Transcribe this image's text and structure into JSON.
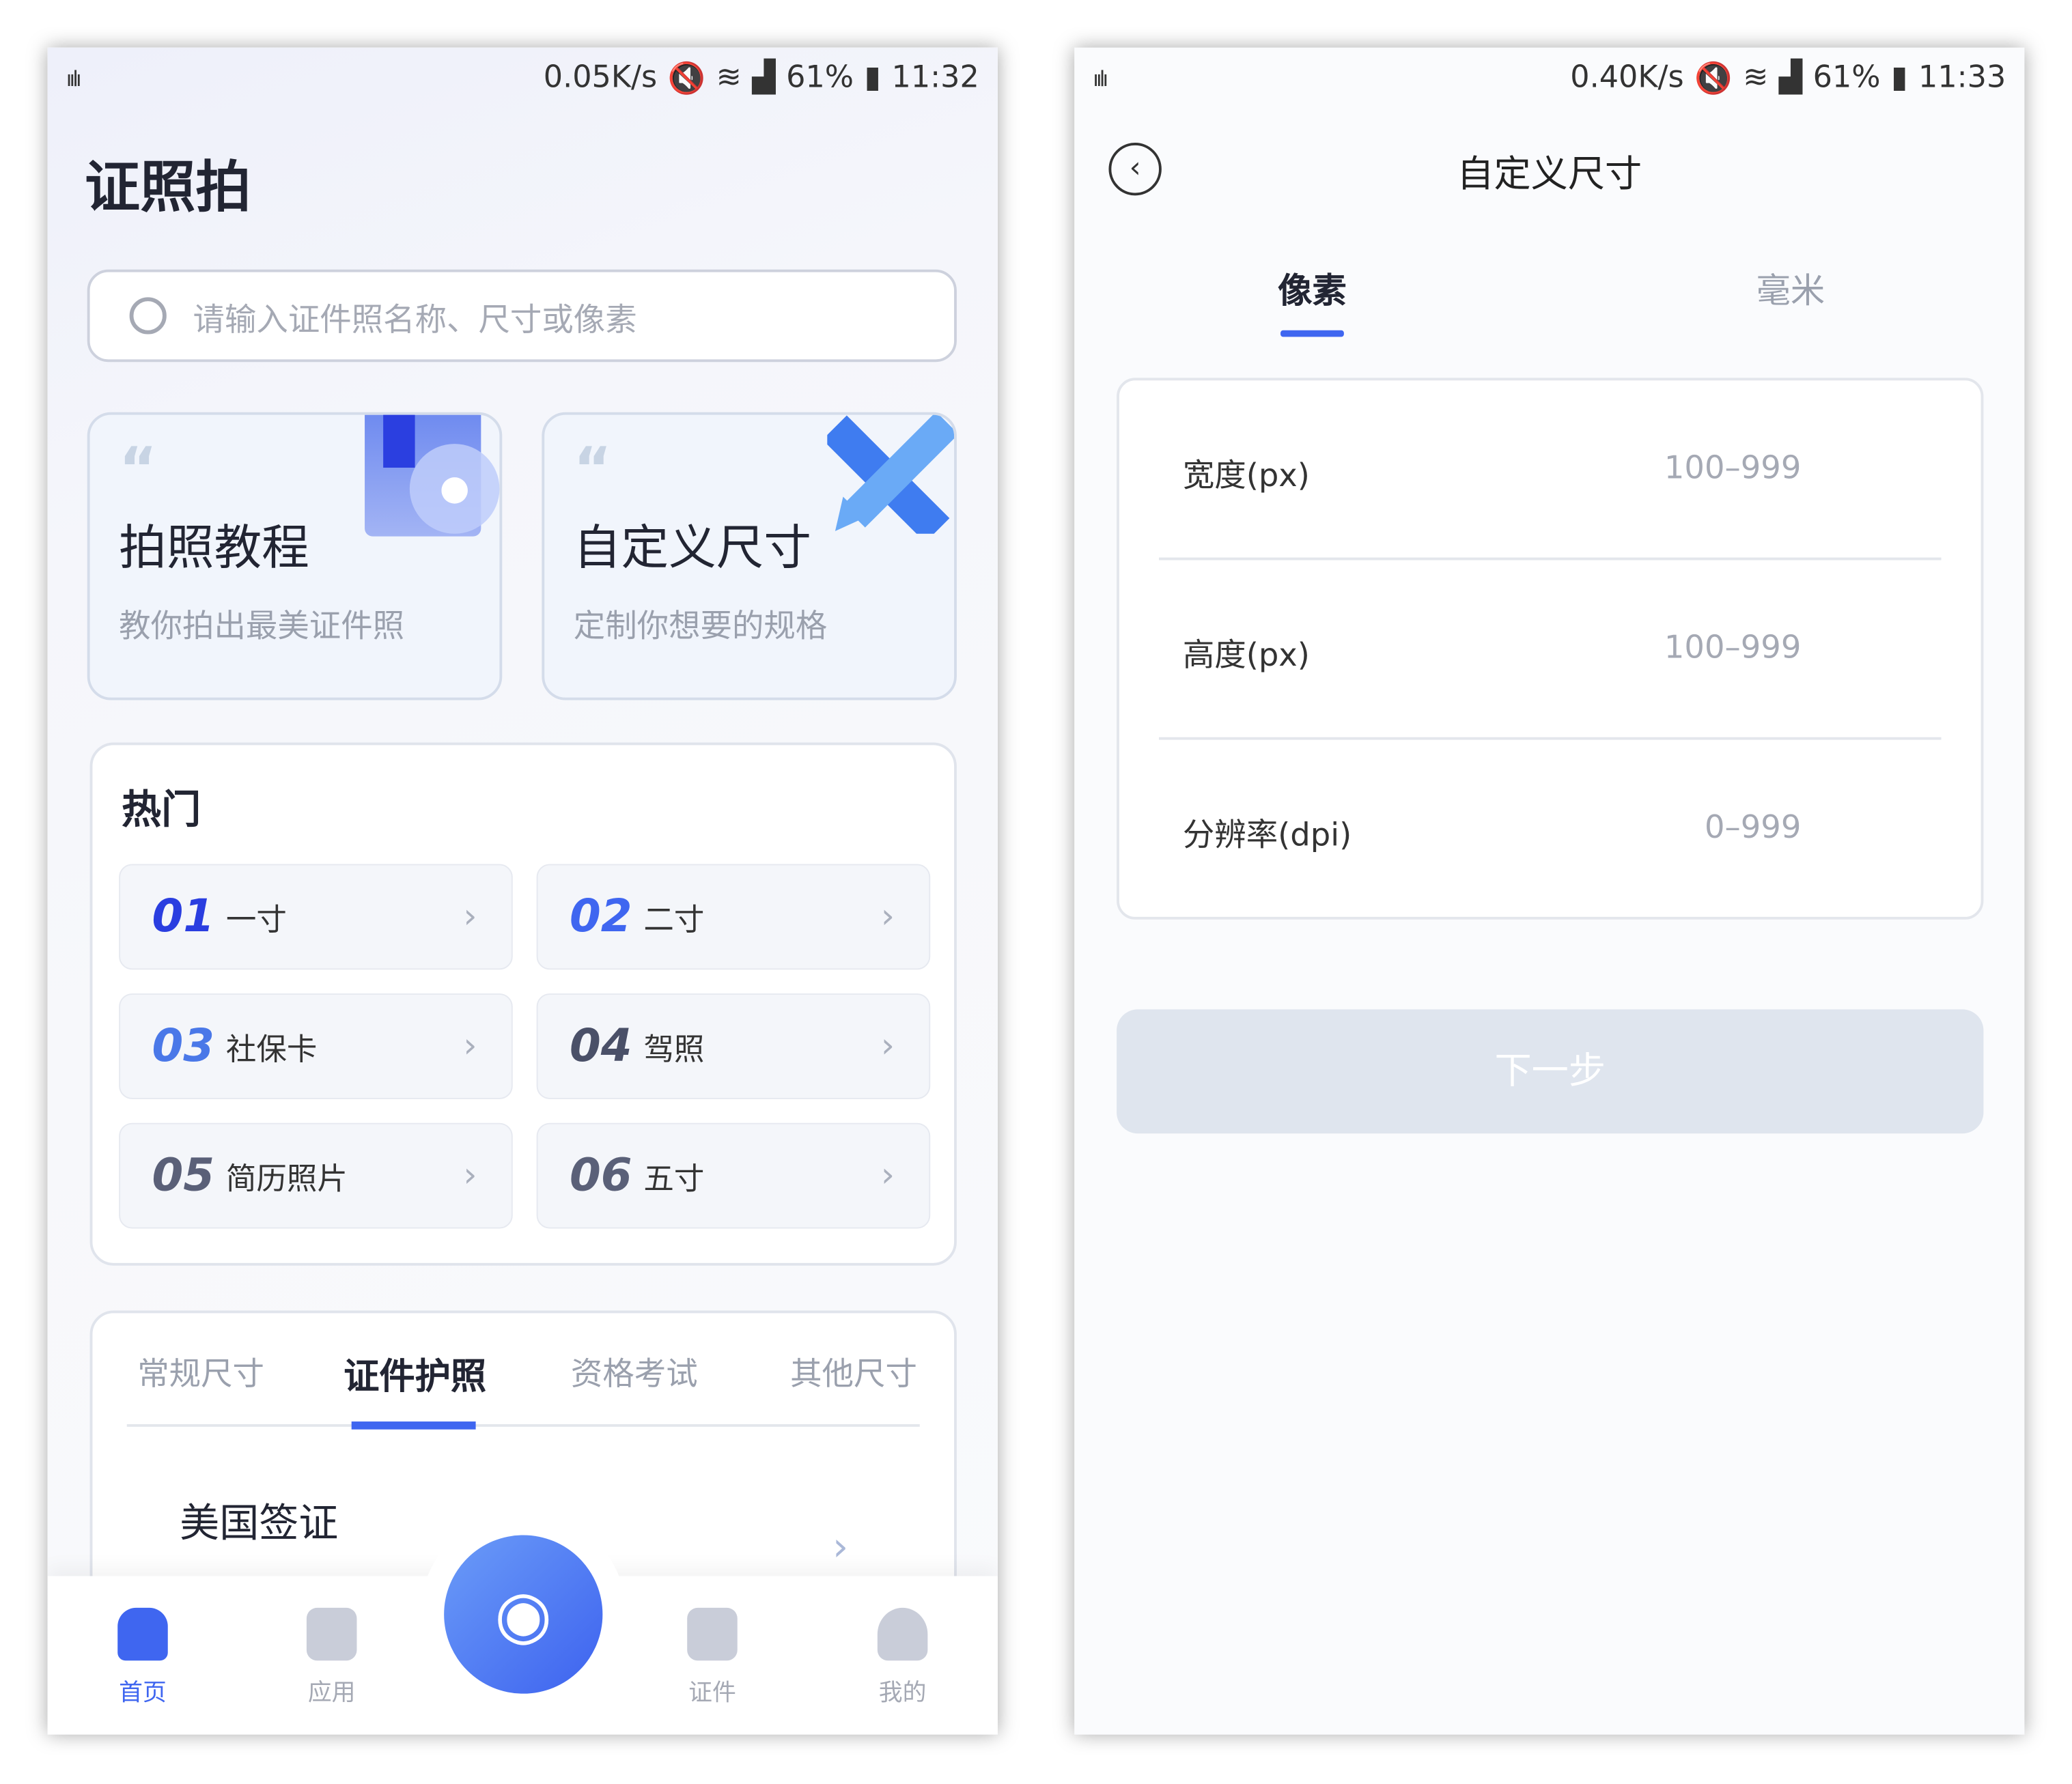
{
  "left": {
    "status": {
      "speed": "0.05K/s",
      "battery": "61%",
      "time": "11:32"
    },
    "app_title": "证照拍",
    "search": {
      "placeholder": "请输入证件照名称、尺寸或像素"
    },
    "cards": [
      {
        "title": "拍照教程",
        "subtitle": "教你拍出最美证件照",
        "icon": "book-camera-icon"
      },
      {
        "title": "自定义尺寸",
        "subtitle": "定制你想要的规格",
        "icon": "ruler-pencil-icon"
      }
    ],
    "hot": {
      "title": "热门",
      "items": [
        {
          "num": "01",
          "label": "一寸"
        },
        {
          "num": "02",
          "label": "二寸"
        },
        {
          "num": "03",
          "label": "社保卡"
        },
        {
          "num": "04",
          "label": "驾照"
        },
        {
          "num": "05",
          "label": "简历照片"
        },
        {
          "num": "06",
          "label": "五寸"
        }
      ]
    },
    "tabs": [
      "常规尺寸",
      "证件护照",
      "资格考试",
      "其他尺寸"
    ],
    "active_tab": "证件护照",
    "list_item": "美国签证",
    "nav": [
      {
        "label": "首页",
        "icon": "home-icon"
      },
      {
        "label": "应用",
        "icon": "apps-icon"
      },
      {
        "label": "证件",
        "icon": "document-icon"
      },
      {
        "label": "我的",
        "icon": "profile-icon"
      }
    ],
    "accent": "#3f66f0"
  },
  "right": {
    "status": {
      "speed": "0.40K/s",
      "battery": "61%",
      "time": "11:33"
    },
    "title": "自定义尺寸",
    "tabs": [
      "像素",
      "毫米"
    ],
    "active_tab": "像素",
    "fields": [
      {
        "label": "宽度(px)",
        "placeholder": "100–999"
      },
      {
        "label": "高度(px)",
        "placeholder": "100–999"
      },
      {
        "label": "分辨率(dpi)",
        "placeholder": "0–999"
      }
    ],
    "next_label": "下一步"
  }
}
